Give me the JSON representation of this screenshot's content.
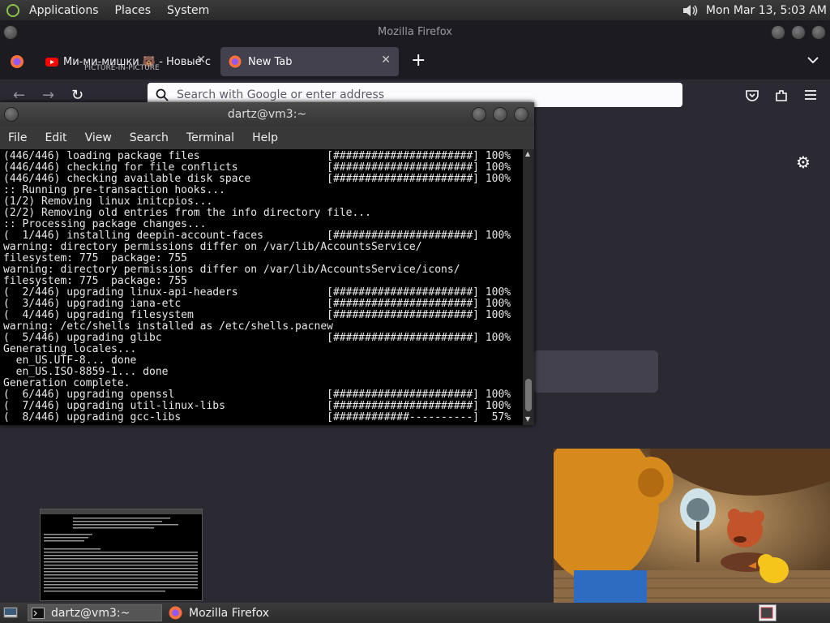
{
  "top_panel": {
    "menus": [
      "Applications",
      "Places",
      "System"
    ],
    "clock": "Mon Mar 13,  5:03 AM"
  },
  "firefox": {
    "window_title": "Mozilla Firefox",
    "tabs": [
      {
        "title": "Ми-ми-мишки 🐻 - Новые с",
        "subtitle": "PICTURE-IN-PICTURE"
      },
      {
        "title": "New Tab"
      }
    ],
    "new_tab_symbol": "+",
    "url_placeholder": "Search with Google or enter address"
  },
  "terminal": {
    "title": "dartz@vm3:~",
    "menu": [
      "File",
      "Edit",
      "View",
      "Search",
      "Terminal",
      "Help"
    ],
    "lines": [
      "(446/446) loading package files                    [######################] 100%",
      "(446/446) checking for file conflicts              [######################] 100%",
      "(446/446) checking available disk space            [######################] 100%",
      ":: Running pre-transaction hooks...",
      "(1/2) Removing linux initcpios...",
      "(2/2) Removing old entries from the info directory file...",
      ":: Processing package changes...",
      "(  1/446) installing deepin-account-faces          [######################] 100%",
      "warning: directory permissions differ on /var/lib/AccountsService/",
      "filesystem: 775  package: 755",
      "warning: directory permissions differ on /var/lib/AccountsService/icons/",
      "filesystem: 775  package: 755",
      "(  2/446) upgrading linux-api-headers              [######################] 100%",
      "(  3/446) upgrading iana-etc                       [######################] 100%",
      "(  4/446) upgrading filesystem                     [######################] 100%",
      "warning: /etc/shells installed as /etc/shells.pacnew",
      "(  5/446) upgrading glibc                          [######################] 100%",
      "Generating locales...",
      "  en_US.UTF-8... done",
      "  en_US.ISO-8859-1... done",
      "Generation complete.",
      "(  6/446) upgrading openssl                        [######################] 100%",
      "(  7/446) upgrading util-linux-libs                [######################] 100%",
      "(  8/446) upgrading gcc-libs                       [############----------]  57%"
    ]
  },
  "taskbar": {
    "items": [
      "dartz@vm3:~",
      "Mozilla Firefox"
    ]
  }
}
